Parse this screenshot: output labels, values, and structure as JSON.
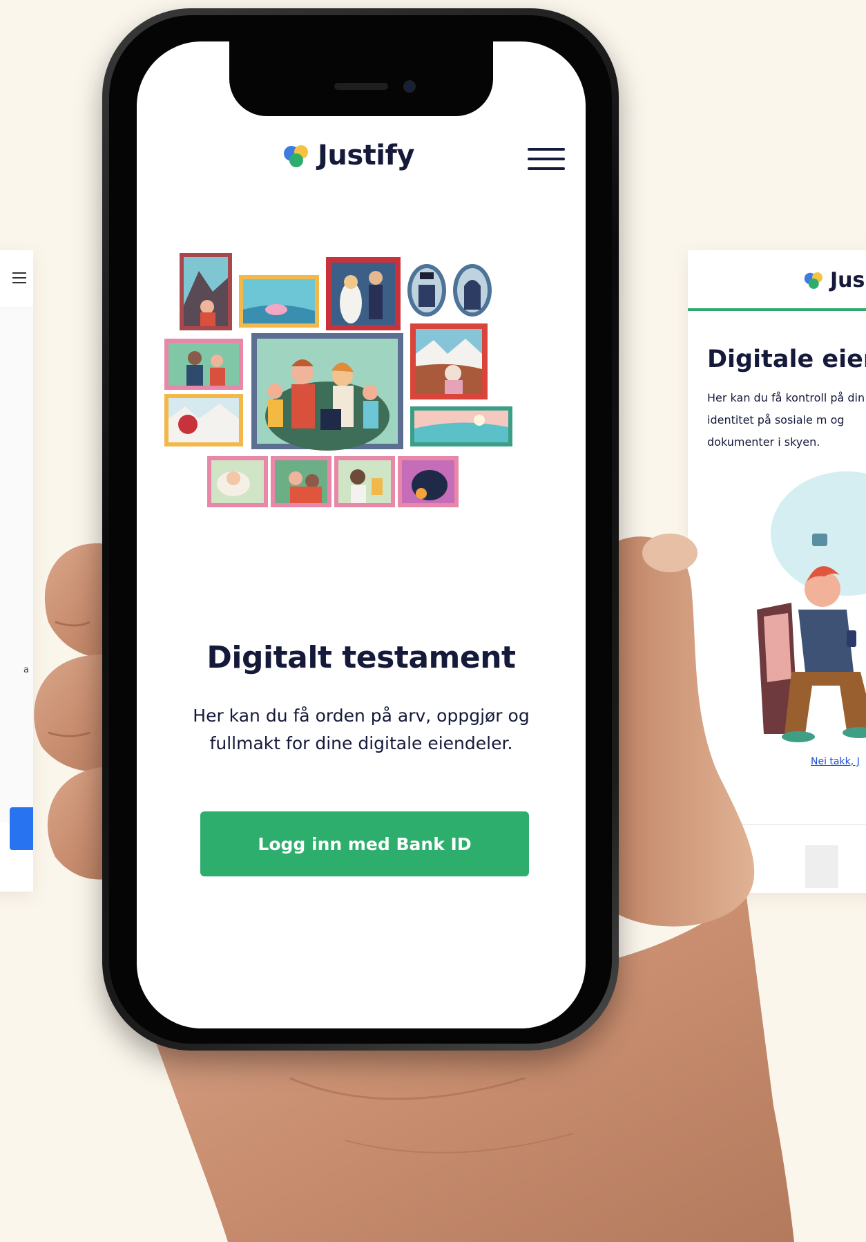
{
  "left_screen": {
    "text_fragment": "a"
  },
  "main_screen": {
    "brand": "Justify",
    "title": "Digitalt testament",
    "subtitle": "Her kan du få orden på arv, oppgjør og fullmakt for dine digitale eiendeler.",
    "login_button": "Logg inn med Bank ID"
  },
  "right_screen": {
    "brand": "Jus",
    "title": "Digitale eienc",
    "subtitle": "Her kan du få kontroll på din identitet på sosiale m og dokumenter i skyen.",
    "link": "Nei takk, J"
  },
  "colors": {
    "background": "#fbf6ec",
    "navy": "#151a3a",
    "accent_green": "#2eae6c",
    "link_blue": "#1b4fd0",
    "left_button_blue": "#2874f0"
  }
}
